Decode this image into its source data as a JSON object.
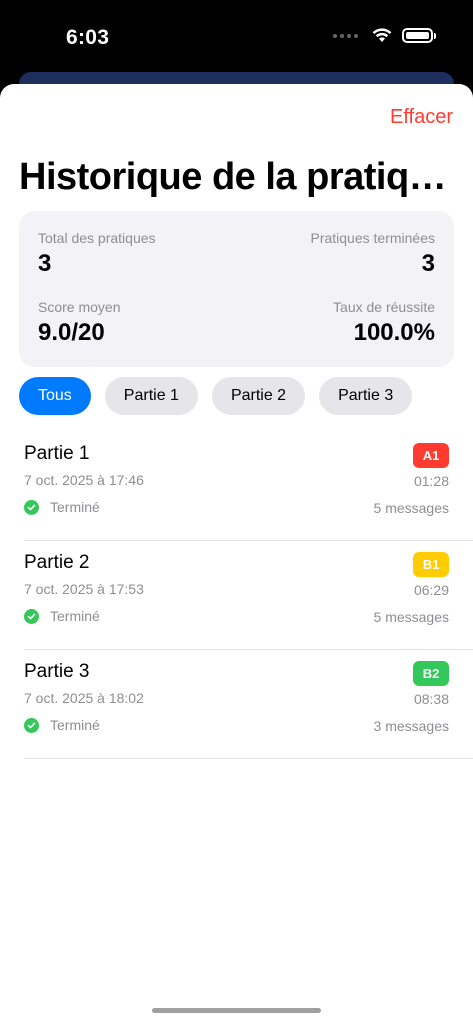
{
  "status_bar": {
    "time": "6:03"
  },
  "header": {
    "clear_label": "Effacer",
    "title": "Historique de la pratiq…"
  },
  "stats": {
    "total_label": "Total des pratiques",
    "total_value": "3",
    "done_label": "Pratiques terminées",
    "done_value": "3",
    "avg_label": "Score moyen",
    "avg_value": "9.0/20",
    "rate_label": "Taux de réussite",
    "rate_value": "100.0%"
  },
  "filters": [
    "Tous",
    "Partie 1",
    "Partie 2",
    "Partie 3"
  ],
  "sessions": [
    {
      "title": "Partie 1",
      "date": "7 oct. 2025 à 17:46",
      "status": "Terminé",
      "level": "A1",
      "level_color": "#ff3b30",
      "duration": "01:28",
      "messages": "5 messages"
    },
    {
      "title": "Partie 2",
      "date": "7 oct. 2025 à 17:53",
      "status": "Terminé",
      "level": "B1",
      "level_color": "#ffcc00",
      "duration": "06:29",
      "messages": "5 messages"
    },
    {
      "title": "Partie 3",
      "date": "7 oct. 2025 à 18:02",
      "status": "Terminé",
      "level": "B2",
      "level_color": "#34c759",
      "duration": "08:38",
      "messages": "3 messages"
    }
  ],
  "colors": {
    "accent": "#007aff",
    "destructive": "#ff3b30",
    "success": "#34c759"
  }
}
